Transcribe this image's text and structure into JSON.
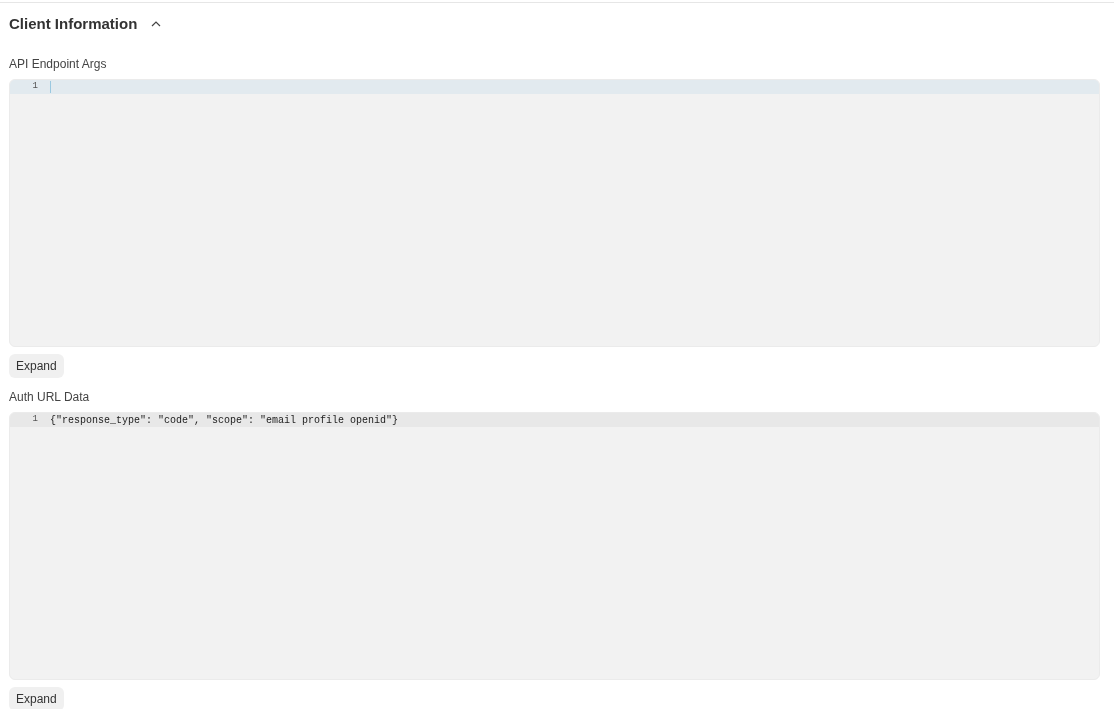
{
  "section": {
    "title": "Client Information",
    "expanded": true
  },
  "fields": [
    {
      "label": "API Endpoint Args",
      "focused": true,
      "lines": [
        {
          "number": "1"
        }
      ],
      "button": "Expand"
    },
    {
      "label": "Auth URL Data",
      "focused": false,
      "lines": [
        {
          "number": "1",
          "code": "{\"response_type\": \"code\", \"scope\": \"email profile openid\"}"
        }
      ],
      "button": "Expand"
    }
  ]
}
